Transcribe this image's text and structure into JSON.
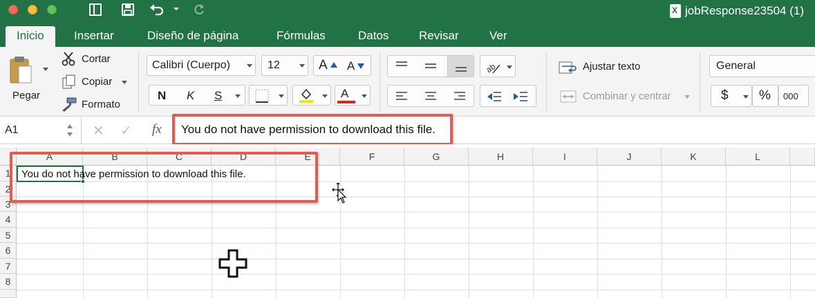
{
  "window": {
    "title": "jobResponse23504 (1)"
  },
  "tabs": [
    {
      "label": "Inicio",
      "active": true
    },
    {
      "label": "Insertar"
    },
    {
      "label": "Diseño de página"
    },
    {
      "label": "Fórmulas"
    },
    {
      "label": "Datos"
    },
    {
      "label": "Revisar"
    },
    {
      "label": "Ver"
    }
  ],
  "clipboard": {
    "paste": "Pegar",
    "cut": "Cortar",
    "copy": "Copiar",
    "format": "Formato"
  },
  "font": {
    "name": "Calibri (Cuerpo)",
    "size": "12",
    "grow": "A",
    "shrink": "A",
    "bold": "N",
    "italic": "K",
    "underline": "S",
    "font_color_letter": "A"
  },
  "alignment": {
    "wrap_text": "Ajustar texto",
    "merge_center": "Combinar y centrar"
  },
  "number": {
    "format": "General",
    "currency": "$",
    "percent": "%",
    "thousands": "000"
  },
  "formula_bar": {
    "name_box": "A1",
    "cancel": "✕",
    "enter": "✓",
    "fx": "fx",
    "content": "You do not have permission to download this file."
  },
  "sheet": {
    "columns": [
      "A",
      "B",
      "C",
      "D",
      "E",
      "F",
      "G",
      "H",
      "I",
      "J",
      "K",
      "L"
    ],
    "rows": [
      "1",
      "2",
      "3",
      "4",
      "5",
      "6",
      "7",
      "8"
    ],
    "cell_a1": "You do not have permission to download this file."
  },
  "colors": {
    "brand_green": "#217346",
    "highlight_red": "#e35c4f",
    "fill_yellow": "#f7e600",
    "font_red": "#d12a1f"
  },
  "icons": [
    "sidebar-toggle-icon",
    "save-icon",
    "undo-icon",
    "redo-icon",
    "paste-icon",
    "scissors-icon",
    "copy-icon",
    "format-painter-icon",
    "borders-icon",
    "fill-color-icon",
    "orientation-icon",
    "wrap-text-icon",
    "merge-icon",
    "decrease-indent-icon",
    "increase-indent-icon",
    "move-cursor-icon",
    "plus-cursor-icon"
  ]
}
